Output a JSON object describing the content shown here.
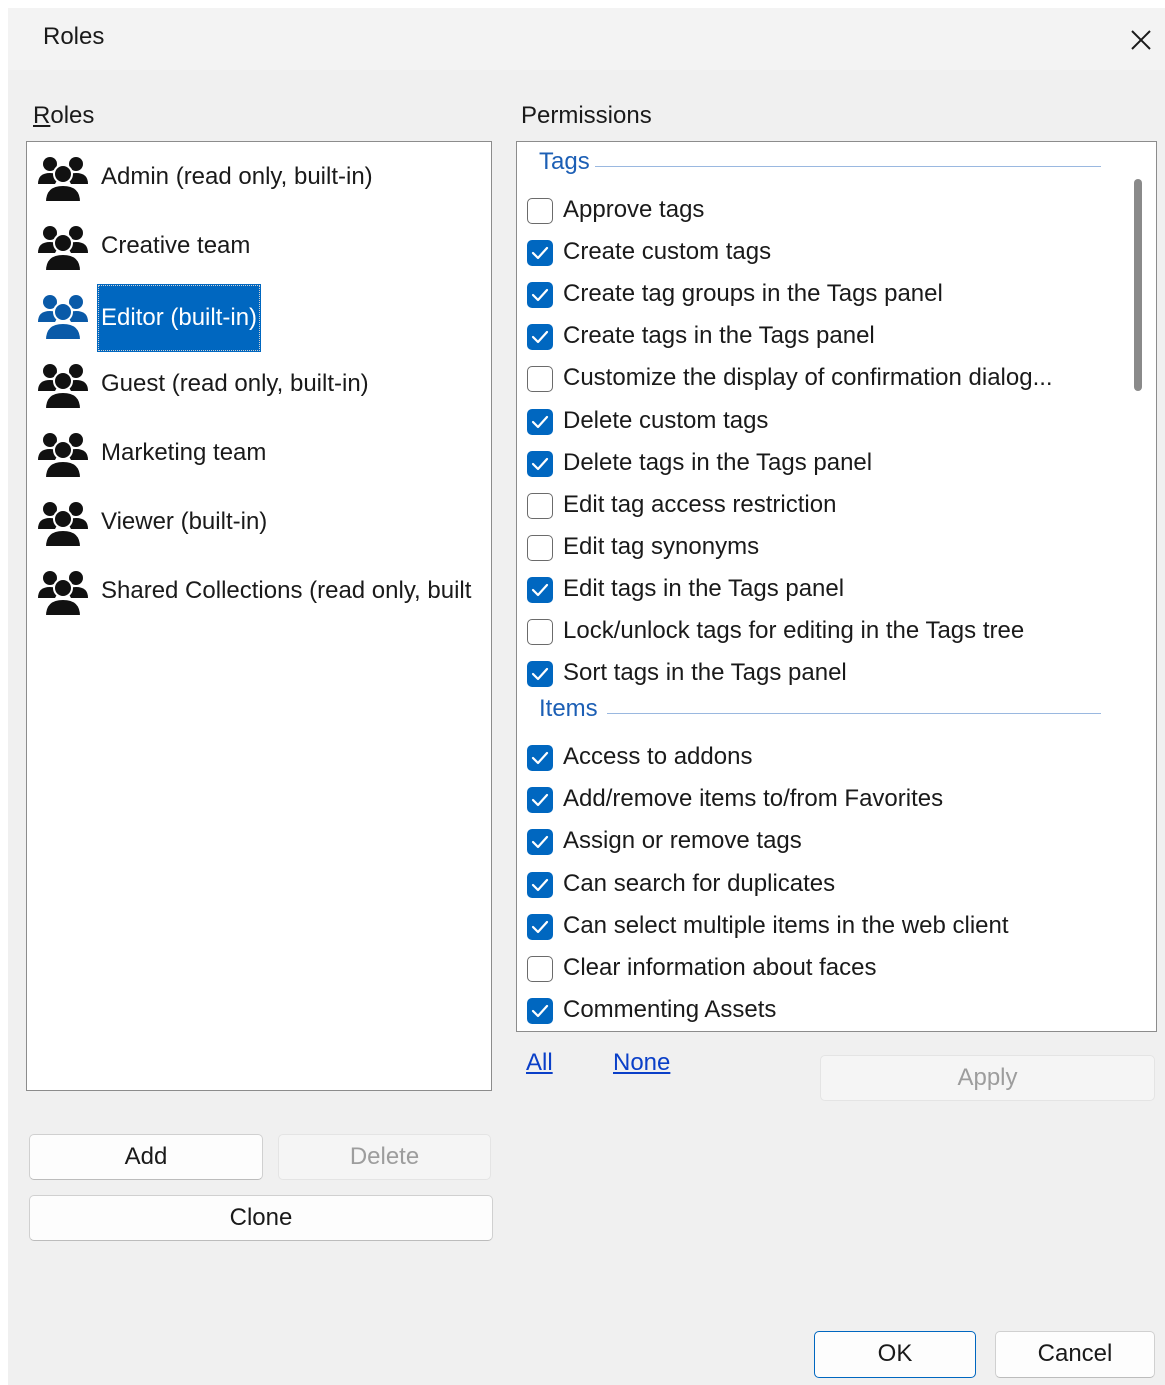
{
  "window": {
    "title": "Roles",
    "close_icon": "close-icon"
  },
  "roles_panel": {
    "label": "Roles",
    "items": [
      {
        "label": "Admin (read only, built-in)",
        "icon": "users-group-icon",
        "selected": false
      },
      {
        "label": "Creative team",
        "icon": "users-group-icon",
        "selected": false
      },
      {
        "label": "Editor (built-in)",
        "icon": "users-group-icon",
        "selected": true
      },
      {
        "label": "Guest (read only, built-in)",
        "icon": "users-group-icon",
        "selected": false
      },
      {
        "label": "Marketing team",
        "icon": "users-group-icon",
        "selected": false
      },
      {
        "label": "Viewer (built-in)",
        "icon": "users-group-icon",
        "selected": false
      },
      {
        "label": "Shared Collections (read only, built",
        "icon": "users-group-icon",
        "selected": false
      }
    ]
  },
  "permissions_panel": {
    "label": "Permissions",
    "groups": [
      {
        "name": "Tags",
        "items": [
          {
            "label": "Approve tags",
            "checked": false
          },
          {
            "label": "Create custom tags",
            "checked": true
          },
          {
            "label": "Create tag groups in the Tags panel",
            "checked": true
          },
          {
            "label": "Create tags in the Tags panel",
            "checked": true
          },
          {
            "label": "Customize the display of confirmation dialog...",
            "checked": false
          },
          {
            "label": "Delete custom tags",
            "checked": true
          },
          {
            "label": "Delete tags in the Tags panel",
            "checked": true
          },
          {
            "label": "Edit tag access restriction",
            "checked": false
          },
          {
            "label": "Edit tag synonyms",
            "checked": false
          },
          {
            "label": "Edit tags in the Tags panel",
            "checked": true
          },
          {
            "label": "Lock/unlock tags for editing in the Tags tree",
            "checked": false
          },
          {
            "label": "Sort tags in the Tags panel",
            "checked": true
          }
        ]
      },
      {
        "name": "Items",
        "items": [
          {
            "label": "Access to addons",
            "checked": true
          },
          {
            "label": "Add/remove items to/from Favorites",
            "checked": true
          },
          {
            "label": "Assign or remove tags",
            "checked": true
          },
          {
            "label": "Can search for duplicates",
            "checked": true
          },
          {
            "label": "Can select multiple items in the web client",
            "checked": true
          },
          {
            "label": "Clear information about faces",
            "checked": false
          },
          {
            "label": "Commenting Assets",
            "checked": true
          }
        ]
      }
    ],
    "select_all_link": "All",
    "select_none_link": "None",
    "apply_label": "Apply"
  },
  "buttons": {
    "add": "Add",
    "delete": "Delete",
    "clone": "Clone",
    "ok": "OK",
    "cancel": "Cancel"
  },
  "colors": {
    "accent": "#0067c0",
    "group_header": "#1c5fb5",
    "link": "#0a3fc8"
  }
}
